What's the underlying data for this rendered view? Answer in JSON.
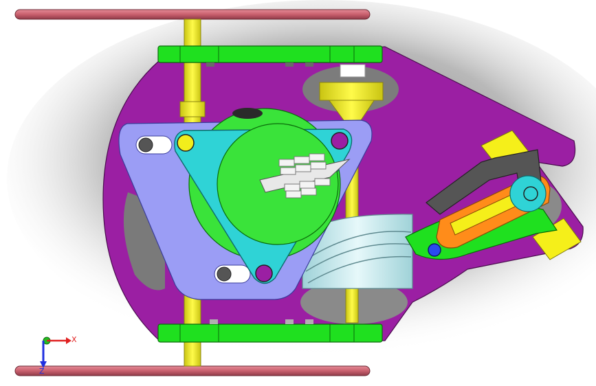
{
  "axis_triad": {
    "x_label": "X",
    "z_label": "Z",
    "x_color": "#e02020",
    "y_color": "#20c020",
    "z_color": "#2030e0"
  },
  "colors": {
    "background": "#ffffff",
    "frame_plate": "#9b1fa3",
    "rail": "#c9606e",
    "bracket": "#1fe01f",
    "shaft": "#f2ee1c",
    "mount_plate": "#9b9df5",
    "tri_flange": "#2fd3d6",
    "gear_disc": "#3ae33a",
    "cam_drum": "#bfe8ee",
    "lever": "#555555",
    "link": "#ff8c1a",
    "pin_block": "#f5ef1a"
  }
}
